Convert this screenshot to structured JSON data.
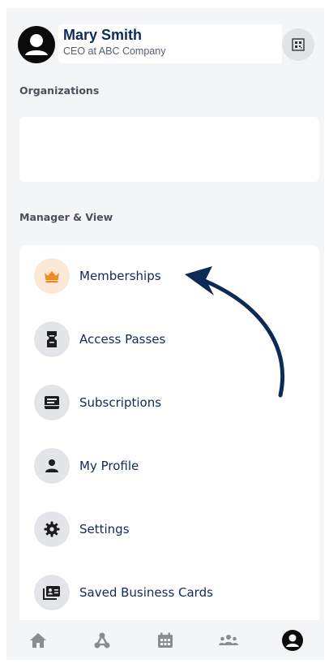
{
  "profile": {
    "name": "Mary Smith",
    "role": "CEO at ABC Company",
    "avatar_icon": "user-avatar-icon",
    "qr_icon": "qr-code-icon"
  },
  "sections": {
    "organizations": "Organizations",
    "manager_view": "Manager & View"
  },
  "menu": [
    {
      "label": "Memberships",
      "icon": "crown-icon",
      "active": true
    },
    {
      "label": "Access Passes",
      "icon": "ticket-icon",
      "active": false
    },
    {
      "label": "Subscriptions",
      "icon": "inbox-icon",
      "active": false
    },
    {
      "label": "My Profile",
      "icon": "person-icon",
      "active": false
    },
    {
      "label": "Settings",
      "icon": "gear-icon",
      "active": false
    },
    {
      "label": "Saved Business Cards",
      "icon": "contact-card-icon",
      "active": false
    }
  ],
  "bottom_nav": [
    {
      "icon": "home-icon",
      "active": false
    },
    {
      "icon": "network-icon",
      "active": false
    },
    {
      "icon": "calendar-icon",
      "active": false
    },
    {
      "icon": "group-icon",
      "active": false
    },
    {
      "icon": "profile-icon",
      "active": true
    }
  ],
  "colors": {
    "accent_active": "#f08a1c",
    "navy": "#0f2b5b",
    "icon_dark": "#1c1c1c",
    "nav_inactive": "#8a8c90"
  }
}
